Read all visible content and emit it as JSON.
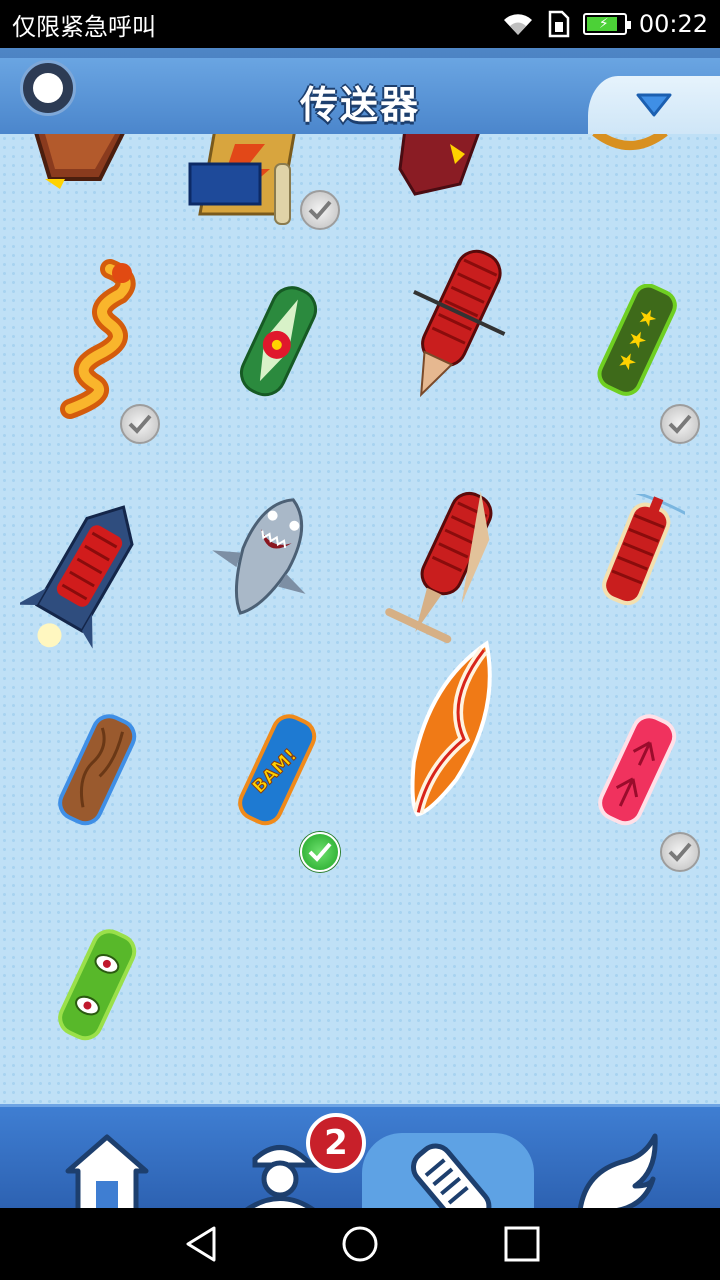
{
  "status_bar": {
    "carrier_text": "仅限紧急呼叫",
    "time": "00:22",
    "battery_percent": 75,
    "icons": [
      "wifi-icon",
      "sim-icon",
      "battery-charging-icon"
    ]
  },
  "header": {
    "title": "传送器",
    "menu_icon": "circle-icon",
    "filter_icon": "chevron-down-icon"
  },
  "grid": {
    "columns": 4,
    "items": [
      {
        "name": "boat-board",
        "state": "partial",
        "owned": false,
        "selected": false
      },
      {
        "name": "scroll-board",
        "state": "partial",
        "owned": true,
        "selected": false
      },
      {
        "name": "magic-carpet-board",
        "state": "partial",
        "owned": false,
        "selected": false
      },
      {
        "name": "pretzel-board",
        "state": "partial",
        "owned": false,
        "selected": false
      },
      {
        "name": "dragon-board",
        "owned": true,
        "selected": false
      },
      {
        "name": "hibiscus-board",
        "owned": false,
        "selected": false
      },
      {
        "name": "red-jetboard",
        "owned": false,
        "selected": false
      },
      {
        "name": "star-board",
        "owned": true,
        "selected": false
      },
      {
        "name": "rocket-board",
        "owned": false,
        "selected": false
      },
      {
        "name": "shark-board",
        "owned": false,
        "selected": false
      },
      {
        "name": "airplane-board",
        "owned": false,
        "selected": false
      },
      {
        "name": "propeller-board",
        "owned": false,
        "selected": false
      },
      {
        "name": "wood-board",
        "owned": false,
        "selected": false
      },
      {
        "name": "bam-board",
        "owned": true,
        "selected": true
      },
      {
        "name": "surf-board",
        "owned": false,
        "selected": false
      },
      {
        "name": "palm-board",
        "owned": true,
        "selected": false
      },
      {
        "name": "monster-eye-board",
        "owned": false,
        "selected": false
      }
    ]
  },
  "bottom_nav": {
    "items": [
      {
        "icon": "home-icon",
        "active": false
      },
      {
        "icon": "character-icon",
        "active": false
      },
      {
        "icon": "hoverboard-icon",
        "active": true
      },
      {
        "icon": "wing-icon",
        "active": false
      }
    ],
    "badge_count": "2"
  },
  "system_nav": {
    "icons": [
      "back-icon",
      "home-circle-icon",
      "recents-icon"
    ]
  },
  "colors": {
    "background": "#bfe0f6",
    "header": "#4b86cc",
    "nav": "#3f7ed2",
    "badge": "#c8202a",
    "check_selected": "#1fa526"
  }
}
